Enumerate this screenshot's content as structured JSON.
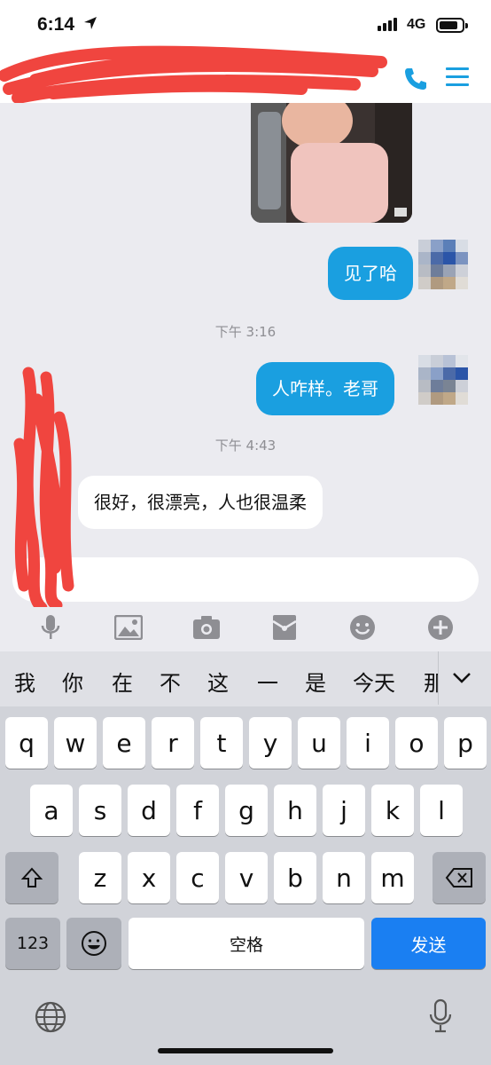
{
  "status_bar": {
    "time": "6:14",
    "network": "4G"
  },
  "colors": {
    "accent": "#1a9fe0",
    "send": "#1a7ff2",
    "redaction": "#f0453f"
  },
  "header": {
    "call_icon": "phone-icon",
    "menu_icon": "menu-icon"
  },
  "messages": [
    {
      "side": "me",
      "type": "image"
    },
    {
      "side": "me",
      "type": "text",
      "text": "见了哈"
    },
    {
      "type": "timestamp",
      "text": "下午 3:16"
    },
    {
      "side": "me",
      "type": "text",
      "text": "人咋样。老哥"
    },
    {
      "type": "timestamp",
      "text": "下午 4:43"
    },
    {
      "side": "them",
      "type": "text",
      "text": "很好，很漂亮，人也很温柔"
    }
  ],
  "input": {
    "value": "",
    "placeholder": ""
  },
  "toolbar": [
    "mic-icon",
    "image-icon",
    "camera-icon",
    "red-packet-icon",
    "emoji-icon",
    "plus-icon"
  ],
  "keyboard": {
    "candidates": [
      "我",
      "你",
      "在",
      "不",
      "这",
      "一",
      "是",
      "今天",
      "那"
    ],
    "row1": [
      "q",
      "w",
      "e",
      "r",
      "t",
      "y",
      "u",
      "i",
      "o",
      "p"
    ],
    "row2": [
      "a",
      "s",
      "d",
      "f",
      "g",
      "h",
      "j",
      "k",
      "l"
    ],
    "row3": [
      "z",
      "x",
      "c",
      "v",
      "b",
      "n",
      "m"
    ],
    "num_label": "123",
    "space_label": "空格",
    "send_label": "发送"
  }
}
